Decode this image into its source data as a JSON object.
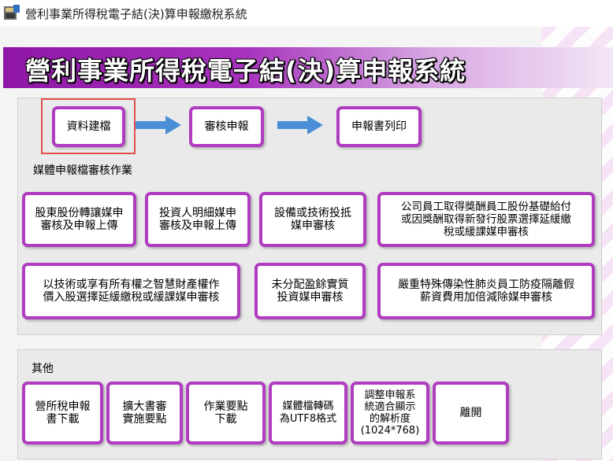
{
  "window": {
    "title": "營利事業所得稅電子結(決)算申報繳稅系統"
  },
  "banner": {
    "title": "營利事業所得稅電子結(決)算申報系統"
  },
  "steps": {
    "data_entry": "資料建檔",
    "review": "審核申報",
    "print": "申報書列印"
  },
  "media_section": {
    "label": "媒體申報檔審核作業",
    "buttons": [
      "股東股份轉讓媒申\n審核及申報上傳",
      "投資人明細媒申\n審核及申報上傳",
      "設備或技術投抵\n媒申審核",
      "公司員工取得獎酬員工股份基礎給付\n或因獎酬取得新發行股票選擇延緩繳\n稅或緩課媒申審核",
      "以技術或享有所有權之智慧財產權作\n價入股選擇延緩繳稅或緩課媒申審核",
      "未分配盈餘實質\n投資媒申審核",
      "嚴重特殊傳染性肺炎員工防疫隔離假\n薪資費用加倍減除媒申審核"
    ]
  },
  "other_section": {
    "label": "其他",
    "buttons": [
      "營所稅申報\n書下載",
      "擴大書審\n實施要點",
      "作業要點\n下載",
      "媒體檔轉碼\n為UTF8格式",
      "調整申報系\n統適合顯示\n的解析度\n(1024*768)",
      "離開"
    ]
  },
  "colors": {
    "accent": "#b03cc0",
    "banner": "#8f16a6",
    "arrow": "#4a8fd6",
    "selection": "#e0514a"
  }
}
